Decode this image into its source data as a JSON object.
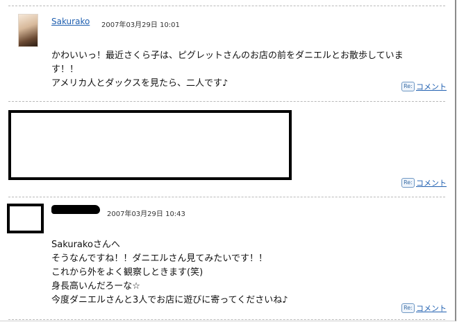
{
  "comments": [
    {
      "author": "Sakurako",
      "date": "2007年03月29日 10:01",
      "lines": [
        "かわいいっ！最近さくら子は、ピグレットさんのお店の前をダニエルとお散歩していま",
        "す！！",
        "アメリカ人とダックスを見たら、二人です♪"
      ],
      "reply_label": "コメント",
      "reply_icon_text": "Re:"
    },
    {
      "reply_label": "コメント",
      "reply_icon_text": "Re:"
    },
    {
      "date": "2007年03月29日 10:43",
      "lines": [
        "Sakurakoさんへ",
        "そうなんですね！！ダニエルさん見てみたいです！！",
        "これから外をよく観察しときます(笑)",
        "身長高いんだろーな☆",
        "今度ダニエルさんと3人でお店に遊びに寄ってくださいね♪"
      ],
      "reply_label": "コメント",
      "reply_icon_text": "Re:"
    }
  ]
}
